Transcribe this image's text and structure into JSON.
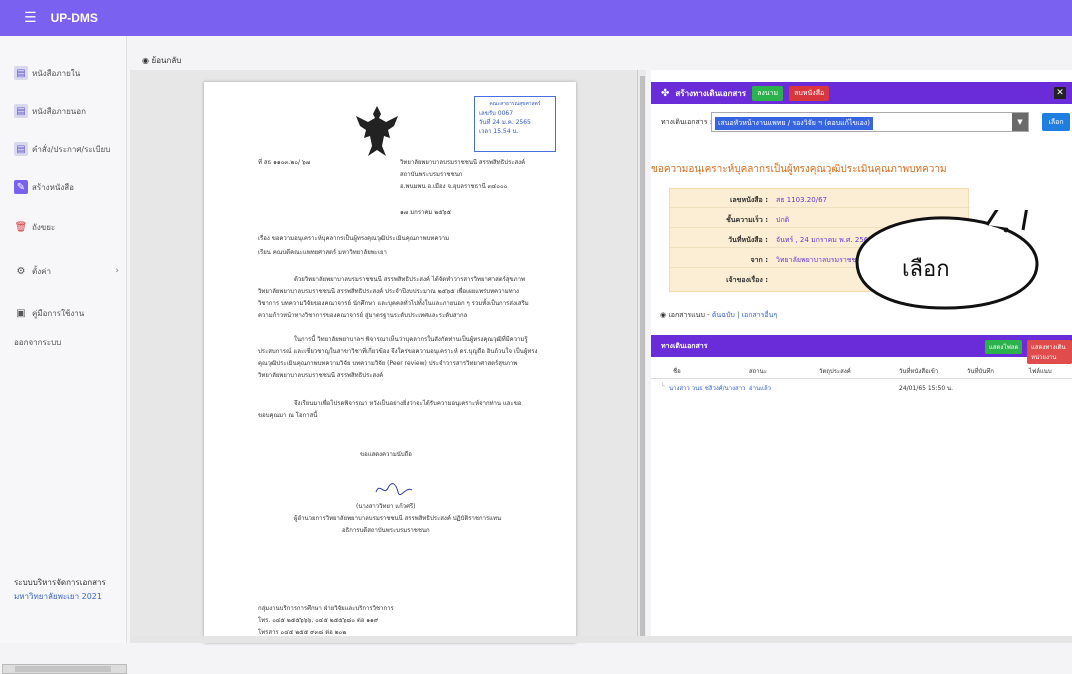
{
  "app": {
    "title": "UP-DMS"
  },
  "sidebar": {
    "items": [
      {
        "label": "หนังสือภายใน",
        "icon": "inbox-doc-icon"
      },
      {
        "label": "หนังสือภายนอก",
        "icon": "outbox-doc-icon"
      },
      {
        "label": "คำสั่ง/ประกาศ/ระเบียบ",
        "icon": "order-doc-icon"
      },
      {
        "label": "สร้างหนังสือ",
        "icon": "create-doc-icon"
      },
      {
        "label": "ถังขยะ",
        "icon": "trash-icon"
      },
      {
        "label": "ตั้งค่า",
        "icon": "settings-icon"
      },
      {
        "label": "คู่มือการใช้งาน",
        "icon": "manual-icon"
      }
    ],
    "logout": "ออกจากระบบ",
    "footer_title": "ระบบบริหารจัดการเอกสาร",
    "footer_org": "มหาวิทยาลัยพะเยา 2021"
  },
  "viewer": {
    "back_label": "ย้อนกลับ",
    "stamp": {
      "title": "คณะสาธารณสุขศาสตร์",
      "no": "เลขรับ 0067",
      "date": "วันที่ 24 ม.ค. 2565",
      "time": "เวลา 15.54 น."
    },
    "doc": {
      "ref": "ที่ สธ ๑๑๐๓.๒๐/ ๖๗",
      "org1": "วิทยาลัยพยาบาลบรมราชชนนี สรรพสิทธิประสงค์",
      "org2": "สถาบันพระบรมราชชนก",
      "org3": "อ.พนมพน อ.เมือง จ.อุบลราชธานี ๓๔๐๐๐",
      "date": "๑๗ มกราคม ๒๕๖๕",
      "subject": "เรื่อง   ขอความอนุเคราะห์บุคลากรเป็นผู้ทรงคุณวุฒิประเมินคุณภาพบทความ",
      "to": "เรียน   คณบดีคณะแพทยศาสตร์ มหาวิทยาลัยพะเยา",
      "para1": "ด้วยวิทยาลัยพยาบาลบรมราชชนนี สรรพสิทธิประสงค์ ได้จัดทำวารสารวิทยาศาสตร์สุขภาพ วิทยาลัยพยาบาลบรมราชชนนี สรรพสิทธิประสงค์ ประจำปีงบประมาณ ๒๕๖๕ เพื่อเผยแพร่บทความทางวิชาการ บทความวิจัยของคณาจารย์ นักศึกษา และบุคคลทั่วไปทั้งในและภายนอก ๆ รวมทั้งเป็นการส่งเสริมความก้าวหน้าทางวิชาการของคณาจารย์ สู่มาตรฐานระดับประเทศและระดับสากล",
      "para2": "ในการนี้ วิทยาลัยพยาบาลฯ พิจารณาเห็นว่าบุคลากรในสังกัดท่านเป็นผู้ทรงคุณวุฒิที่มีความรู้ ประสบการณ์ และเชี่ยวชาญในสาขาวิชาที่เกี่ยวข้อง จึงใคร่ขอความอนุเคราะห์ ดร.บุญถือ อินถ้วนใจ เป็นผู้ทรงคุณวุฒิประเมินคุณภาพบทความวิจัย บทความวิจัย (Peer review) ประจำวารสารวิทยาศาสตร์สุขภาพ วิทยาลัยพยาบาลบรมราชชนนี สรรพสิทธิประสงค์",
      "para3": "จึงเรียนมาเพื่อโปรดพิจารณา หวังเป็นอย่างยิ่งว่าจะได้รับความอนุเคราะห์จากท่าน และขอขอบคุณมา ณ โอกาสนี้",
      "closing": "ขอแสดงความนับถือ",
      "signer": "(นางสาววิทยา แก้วศรี)",
      "signer_title1": "ผู้อำนวยการวิทยาลัยพยาบาลบรมราชชนนี สรรพสิทธิประสงค์ ปฏิบัติราชการแทน",
      "signer_title2": "อธิการบดีสถาบันพระบรมราชชนก",
      "dept": "กลุ่มงานบริการการศึกษา ฝ่ายวิจัยและบริการวิชาการ",
      "phone": "โทร. ๐๔๕ ๒๕๕๖๖๖, ๐๔๕ ๒๕๕๖๘๐ ต่อ ๑๑๙",
      "fax": "โทรสาร ๐๔๕ ๒๕๕ ๙๓๘ ต่อ ๒๐๒"
    }
  },
  "panel": {
    "title": "สร้างทางเดินเอกสาร",
    "btn_sign": "ลงนาม",
    "btn_delete": "ลบหนังสือ",
    "close": "✕",
    "route_label": "ทางเดินเอกสาร :",
    "route_value": "เสนอหัวหน้างานแพทย / รองวิจัย ฯ (ตอบแก้ไขเอง)",
    "pick_label": "เลือก",
    "subject": "ขอความอนุเคราะห์บุคลากรเป็นผู้ทรงคุณวุฒิประเมินคุณภาพบทความ",
    "info": [
      {
        "k": "เลขหนังสือ :",
        "v": "สธ 1103.20/67"
      },
      {
        "k": "ชั้นความเร็ว :",
        "v": "ปกติ"
      },
      {
        "k": "วันที่หนังสือ :",
        "v": "จันทร์ , 24 มกราคม พ.ศ. 2565"
      },
      {
        "k": "จาก :",
        "v": "วิทยาลัยพยาบาลบรมราชชนนี"
      },
      {
        "k": "เจ้าของเรื่อง :",
        "v": ""
      }
    ],
    "callout": "เลือก",
    "attach_label": "เอกสารแนบ",
    "attach_links": "ต้นฉบับ | เอกสารอื่นๆ",
    "route_table": {
      "title": "ทางเดินเอกสาร",
      "btn_add": "แสดงโฟลด",
      "btn_remove": "แสดงทางเดินหน่วยงาน",
      "cols": [
        "ชื่อ",
        "สถานะ",
        "วัตถุประสงค์",
        "วันที่หนังสือเข้า",
        "วันที่บันทึก",
        "ไฟล์แนบ"
      ],
      "rows": [
        {
          "name": "นางสาว วนธ ชลิวงศ์/นางสาว",
          "status": "อ่านแล้ว",
          "purpose": "",
          "in_date": "24/01/65 15:50 น.",
          "saved": "",
          "files": ""
        }
      ]
    }
  }
}
